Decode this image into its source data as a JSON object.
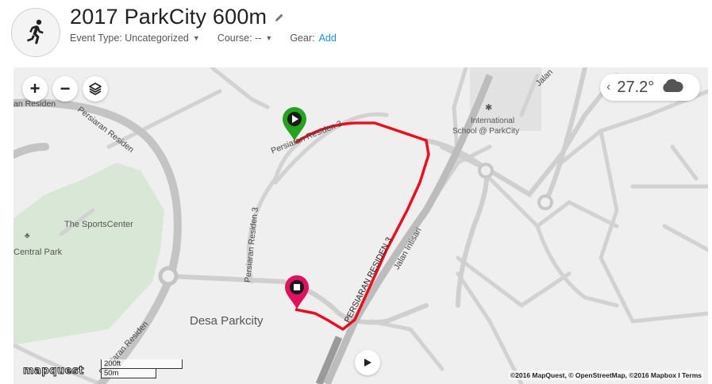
{
  "activity": {
    "title": "2017 ParkCity 600m",
    "icon": "running-person-icon"
  },
  "meta": {
    "event_type_label": "Event Type:",
    "event_type_value": "Uncategorized",
    "course_label": "Course:",
    "course_value": "--",
    "gear_label": "Gear:",
    "gear_link": "Add"
  },
  "map": {
    "zoom_in": "+",
    "zoom_out": "−",
    "weather": {
      "temperature": "27.2°",
      "condition_icon": "cloud-icon"
    },
    "labels": {
      "sports_center": "The SportsCenter",
      "central_park": "Central Park",
      "desa_parkcity": "Desa Parkcity",
      "school": "International",
      "school_line2": "School @ ParkCity",
      "road_persiaran_residen_3_top": "Persiaran Residen 3",
      "road_persiaran_residen_3_left": "Persiaran Residen 3",
      "road_persiaran_residen_3_caps": "PERSIARAN RESIDEN 3",
      "road_jalan_intisari": "Jalan Intisari",
      "road_persiaran_residen_top": "an Residen",
      "road_persiaran_residen_curve": "Persiaran Residen",
      "road_persiaran_residen_bottom": "Persiaran Residen",
      "road_jalan_top_right": "Jalan"
    },
    "scale": {
      "imperial": "200ft",
      "metric": "50m"
    },
    "attribution": "©2016 MapQuest, © OpenStreetMap, ©2016 Mapbox I Terms",
    "logo": "mapquest",
    "colors": {
      "route": "#e8101e",
      "start_pin": "#23a31e",
      "end_pin": "#e0115f",
      "park": "#d6e6d4",
      "road": "#c8c8c8"
    }
  }
}
